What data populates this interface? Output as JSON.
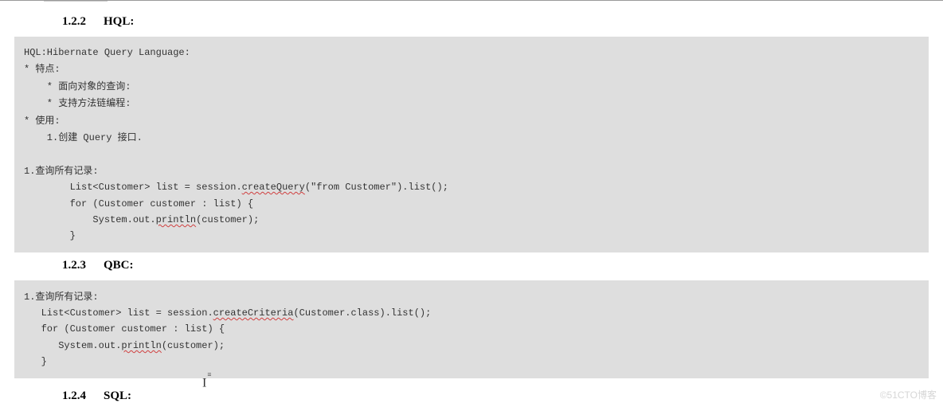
{
  "sections": {
    "s1": {
      "num": "1.2.2",
      "title": "HQL:"
    },
    "s2": {
      "num": "1.2.3",
      "title": "QBC:"
    },
    "s3": {
      "num": "1.2.4",
      "title": "SQL:"
    }
  },
  "hql": {
    "l1a": "HQL:Hibernate Query Language:",
    "l2a": "* ",
    "l2b": "特点",
    "l2c": ":",
    "l3a": "    * ",
    "l3b": "面向对象的查询",
    "l3c": ":",
    "l4a": "    * ",
    "l4b": "支持方法链编程",
    "l4c": ":",
    "l5a": "* ",
    "l5b": "使用",
    "l5c": ":",
    "l6a": "    1.",
    "l6b": "创建",
    "l6c": " Query ",
    "l6d": "接口",
    "l6e": ".",
    "blank": " ",
    "l7a": "1.",
    "l7b": "查询所有记录",
    "l7c": ":",
    "l8a": "        List<Customer> list = session.",
    "l8b": "createQuery",
    "l8c": "(\"from Customer\").list();",
    "l9": "        for (Customer customer : list) {",
    "l10a": "            System.out.",
    "l10b": "println",
    "l10c": "(customer);",
    "l11": "        }"
  },
  "qbc": {
    "l1a": "1.",
    "l1b": "查询所有记录",
    "l1c": ":",
    "l2a": "   List<Customer> list = session.",
    "l2b": "createCriteria",
    "l2c": "(Customer.class).list();",
    "l3": "   for (Customer customer : list) {",
    "l4a": "      System.out.",
    "l4b": "println",
    "l4c": "(customer);",
    "l5": "   }"
  },
  "watermark": "©51CTO博客",
  "cursor": "I"
}
